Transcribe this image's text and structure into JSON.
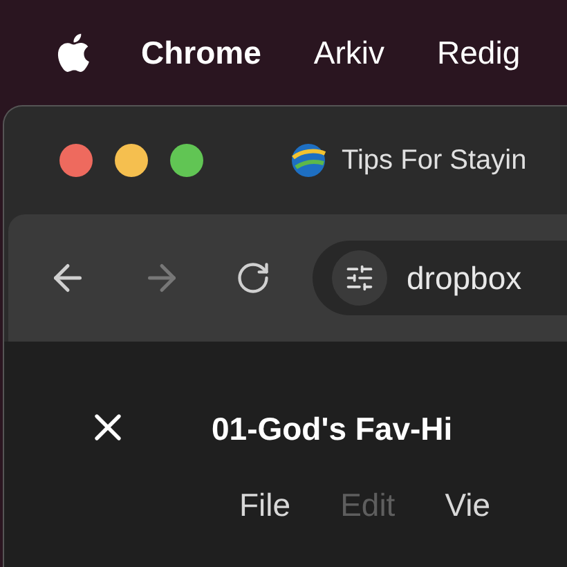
{
  "menubar": {
    "app_name": "Chrome",
    "menus": [
      "Arkiv",
      "Redig"
    ]
  },
  "tab": {
    "title": "Tips For Stayin",
    "selected": true
  },
  "toolbar": {
    "back": {
      "disabled": false
    },
    "forward": {
      "disabled": true
    },
    "address": {
      "value": "dropbox"
    }
  },
  "document": {
    "title": "01-God's Fav-Hi",
    "menu": [
      {
        "label": "File",
        "disabled": false
      },
      {
        "label": "Edit",
        "disabled": true
      },
      {
        "label": "Vie",
        "disabled": false
      }
    ]
  }
}
